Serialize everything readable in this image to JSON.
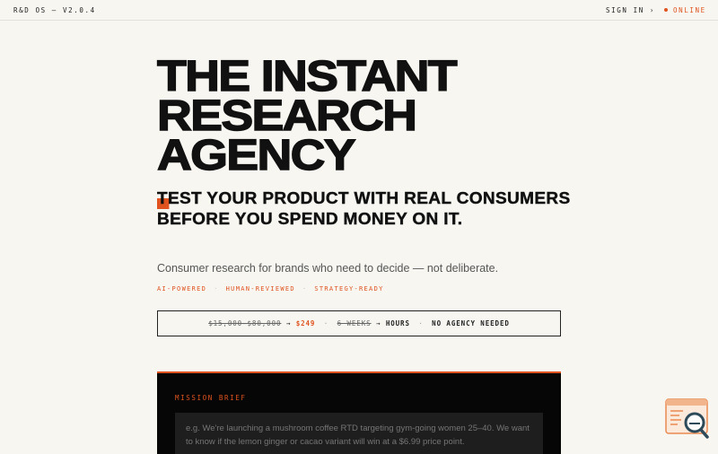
{
  "header": {
    "brand": "R&D OS — V2.0.4",
    "sign_in": "SIGN IN ›",
    "status": "ONLINE"
  },
  "hero": {
    "line1": "THE INSTANT",
    "line2": "RESEARCH",
    "line3": "AGENCY"
  },
  "subhead": "TEST YOUR PRODUCT WITH REAL CONSUMERS BEFORE YOU SPEND MONEY ON IT.",
  "description": "Consumer research for brands who need to decide — not deliberate.",
  "tags": [
    "AI-POWERED",
    "HUMAN-REVIEWED",
    "STRATEGY-READY"
  ],
  "pricing": {
    "old_price": "$15,000–$80,000",
    "arrow": "→",
    "new_price": "$249",
    "old_time": "6 WEEKS",
    "new_time": "HOURS",
    "note": "NO AGENCY NEEDED"
  },
  "mission": {
    "label": "MISSION BRIEF",
    "placeholder": "e.g. We're launching a mushroom coffee RTD targeting gym-going women 25–40. We want to know if the lemon ginger or cacao variant will win at a $6.99 price point."
  },
  "colors": {
    "accent": "#e0531e",
    "background": "#f7f6f1",
    "panel": "#060606"
  },
  "icons": {
    "widget": "chat-search-icon"
  }
}
